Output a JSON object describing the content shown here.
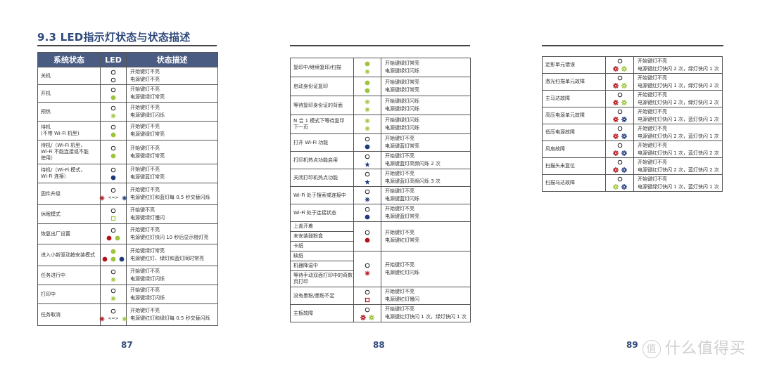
{
  "colors": {
    "header_bg": "#4a5c82",
    "title": "#2f4a7c",
    "green": "#9dc43a",
    "blue": "#1f3a7a",
    "red": "#b5121b"
  },
  "page87": {
    "title": "9.3 LED指示灯状态与状态描述",
    "headers": [
      "系统状态",
      "LED",
      "状态描述"
    ],
    "page_number": "87",
    "rows": [
      {
        "state": "关机",
        "led_top": [
          {
            "icon": "off"
          }
        ],
        "led_bottom": [
          {
            "icon": "off"
          }
        ],
        "desc": [
          "开始键灯不亮",
          "电源键灯不亮"
        ]
      },
      {
        "state": "开机",
        "led_top": [
          {
            "icon": "off"
          }
        ],
        "led_bottom": [
          {
            "icon": "solid",
            "color": "green"
          }
        ],
        "desc": [
          "开始键灯不亮",
          "电源键绿灯常亮"
        ]
      },
      {
        "state": "预热",
        "led_top": [
          {
            "icon": "off"
          }
        ],
        "led_bottom": [
          {
            "icon": "blink",
            "color": "green"
          }
        ],
        "desc": [
          "开始键灯不亮",
          "电源键绿灯闪烁"
        ]
      },
      {
        "state": "待机\n(不带 Wi-Fi 机型)",
        "led_top": [
          {
            "icon": "off"
          }
        ],
        "led_bottom": [
          {
            "icon": "solid",
            "color": "green"
          }
        ],
        "desc": [
          "开始键灯不亮",
          "电源键绿灯常亮"
        ]
      },
      {
        "state": "待机/（Wi-Fi 机型，\nWi-Fi 不能连接或不能\n使用）",
        "led_top": [
          {
            "icon": "off"
          }
        ],
        "led_bottom": [
          {
            "icon": "solid",
            "color": "green"
          }
        ],
        "desc": [
          "开始键灯不亮",
          "电源键绿灯常亮"
        ]
      },
      {
        "state": "待机/（Wi-Fi 模式，\nWi-Fi 连接）",
        "led_top": [
          {
            "icon": "off"
          }
        ],
        "led_bottom": [
          {
            "icon": "solid",
            "color": "blue"
          }
        ],
        "desc": [
          "开始键灯不亮",
          "电源键蓝灯常亮"
        ]
      },
      {
        "state": "固件升级",
        "led_top": [
          {
            "icon": "off"
          }
        ],
        "led_bottom": [
          {
            "icon": "blink",
            "color": "red"
          },
          {
            "icon": "alt"
          },
          {
            "icon": "blink",
            "color": "blue"
          }
        ],
        "desc": [
          "开始键灯不亮",
          "电源键红灯和蓝灯每 0.5 秒交替闪烁"
        ]
      },
      {
        "state": "休眠模式",
        "led_top": [
          {
            "icon": "off"
          }
        ],
        "led_bottom": [
          {
            "icon": "slow",
            "color": "green"
          }
        ],
        "desc": [
          "开始键不亮",
          "电源键绿灯慢闪"
        ]
      },
      {
        "state": "恢复出厂设置",
        "led_top": [
          {
            "icon": "off"
          }
        ],
        "led_bottom": [
          {
            "icon": "solid",
            "color": "red"
          },
          {
            "icon": "solid",
            "color": "green"
          }
        ],
        "desc": [
          "开始键灯不亮",
          "电源键红灯快闪 10 秒后显示橙灯亮"
        ]
      },
      {
        "state": "进入小新驱动按安装模式",
        "led_top": [
          {
            "icon": "solid",
            "color": "green"
          }
        ],
        "led_bottom": [
          {
            "icon": "solid",
            "color": "red"
          },
          {
            "icon": "solid",
            "color": "green"
          },
          {
            "icon": "solid",
            "color": "blue"
          }
        ],
        "desc": [
          "开始键绿灯常亮",
          "电源键红灯、绿灯和蓝灯同时常亮"
        ]
      },
      {
        "state": "任务进行中",
        "led_top": [
          {
            "icon": "off"
          }
        ],
        "led_bottom": [
          {
            "icon": "blink",
            "color": "green"
          }
        ],
        "desc": [
          "开始键灯不亮",
          "电源键绿灯闪烁"
        ]
      },
      {
        "state": "打印中",
        "led_top": [
          {
            "icon": "off"
          }
        ],
        "led_bottom": [
          {
            "icon": "blink",
            "color": "green"
          }
        ],
        "desc": [
          "开始键灯不亮",
          "电源键绿灯闪烁"
        ]
      },
      {
        "state": "任务取消",
        "led_top": [
          {
            "icon": "off"
          }
        ],
        "led_bottom": [
          {
            "icon": "blink",
            "color": "red"
          },
          {
            "icon": "alt"
          },
          {
            "icon": "blink",
            "color": "green"
          }
        ],
        "desc": [
          "开始键灯不亮",
          "电源键红灯和绿灯每 0.5 秒交替闪烁"
        ]
      }
    ]
  },
  "page88": {
    "page_number": "88",
    "rows": [
      {
        "states": [
          "复印中/继续复印/扫描"
        ],
        "led_top": [
          {
            "icon": "solid",
            "color": "green"
          }
        ],
        "led_bottom": [
          {
            "icon": "blink",
            "color": "green"
          }
        ],
        "desc": [
          "开始键绿灯常亮",
          "电源键绿灯闪烁"
        ]
      },
      {
        "states": [
          "启动身份证复印"
        ],
        "led_top": [
          {
            "icon": "solid",
            "color": "green"
          }
        ],
        "led_bottom": [
          {
            "icon": "solid",
            "color": "green"
          }
        ],
        "desc": [
          "开始键绿灯常亮",
          "电源键绿灯常亮"
        ]
      },
      {
        "states": [
          "等待复印身份证的背面"
        ],
        "led_top": [
          {
            "icon": "blink",
            "color": "green"
          }
        ],
        "led_bottom": [
          {
            "icon": "blink",
            "color": "green"
          }
        ],
        "desc": [
          "开始键绿灯闪烁",
          "电源键绿灯闪烁"
        ]
      },
      {
        "states": [
          "N 合 1 模式下等待复印\n下一页"
        ],
        "led_top": [
          {
            "icon": "blink",
            "color": "green"
          }
        ],
        "led_bottom": [
          {
            "icon": "blink",
            "color": "green"
          }
        ],
        "desc": [
          "开始键绿灯闪烁",
          "电源键绿灯闪烁"
        ]
      },
      {
        "states": [
          "打开 Wi-Fi 功能"
        ],
        "led_top": [
          {
            "icon": "off"
          }
        ],
        "led_bottom": [
          {
            "icon": "solid",
            "color": "blue"
          }
        ],
        "desc": [
          "开始键灯不亮",
          "电源键蓝灯常亮"
        ]
      },
      {
        "states": [
          "打印机热点功能启用"
        ],
        "led_top": [
          {
            "icon": "off"
          }
        ],
        "led_bottom": [
          {
            "icon": "star",
            "color": "blue"
          }
        ],
        "desc": [
          "开始键灯不亮",
          "电源键蓝灯高频闪烁 2 次"
        ]
      },
      {
        "states": [
          "关闭打印机热点功能"
        ],
        "led_top": [
          {
            "icon": "off"
          }
        ],
        "led_bottom": [
          {
            "icon": "star",
            "color": "blue"
          }
        ],
        "desc": [
          "开始键灯不亮",
          "电源键蓝灯高频闪烁 3 次"
        ]
      },
      {
        "states": [
          "Wi-Fi 处于搜索或连接中"
        ],
        "led_top": [
          {
            "icon": "off"
          }
        ],
        "led_bottom": [
          {
            "icon": "blink",
            "color": "blue"
          }
        ],
        "desc": [
          "开始键灯不亮",
          "电源键蓝灯闪烁"
        ]
      },
      {
        "states": [
          "Wi-Fi 处于连接状态"
        ],
        "led_top": [
          {
            "icon": "off"
          }
        ],
        "led_bottom": [
          {
            "icon": "solid",
            "color": "blue"
          }
        ],
        "desc": [
          "开始键灯不亮",
          "电源键蓝灯常亮"
        ]
      },
      {
        "states": [
          "上盖开着",
          "未安装鼓粉盒",
          "卡纸"
        ],
        "led_top": [
          {
            "icon": "off"
          }
        ],
        "led_bottom": [
          {
            "icon": "solid",
            "color": "red"
          }
        ],
        "desc": [
          "开始键灯不亮",
          "电源键红灯常亮"
        ]
      },
      {
        "states": [
          "缺纸",
          "机器降温中",
          "等待手动双面打印中的奇数\n页打印"
        ],
        "led_top": [
          {
            "icon": "off"
          }
        ],
        "led_bottom": [
          {
            "icon": "blink",
            "color": "red"
          }
        ],
        "desc": [
          "开始键灯不亮",
          "电源键红灯闪烁"
        ]
      },
      {
        "states": [
          "没有墨粉/墨粉不足"
        ],
        "led_top": [
          {
            "icon": "off"
          }
        ],
        "led_bottom": [
          {
            "icon": "slow",
            "color": "red"
          }
        ],
        "desc": [
          "开始键灯不亮",
          "电源键红灯慢闪"
        ]
      },
      {
        "states": [
          "主板故障"
        ],
        "led_top": [
          {
            "icon": "off"
          }
        ],
        "led_bottom": [
          {
            "icon": "fast",
            "color": "red"
          },
          {
            "icon": "fast",
            "color": "green"
          }
        ],
        "desc": [
          "开始键灯不亮",
          "电源键红灯快闪 1 次，绿灯快闪 1 次"
        ]
      }
    ]
  },
  "page89": {
    "page_number": "89",
    "rows": [
      {
        "state": "定影单元错误",
        "led_top": [
          {
            "icon": "off"
          }
        ],
        "led_bottom": [
          {
            "icon": "fast",
            "color": "red"
          },
          {
            "icon": "fast",
            "color": "green"
          }
        ],
        "desc": [
          "开始键灯不亮",
          "电源键红灯快闪 2 次，绿灯快闪 1 次"
        ]
      },
      {
        "state": "激光扫描单元故障",
        "led_top": [
          {
            "icon": "off"
          }
        ],
        "led_bottom": [
          {
            "icon": "fast",
            "color": "red"
          },
          {
            "icon": "fast",
            "color": "green"
          }
        ],
        "desc": [
          "开始键灯不亮",
          "电源键红灯快闪 1 次，绿灯快闪 2 次"
        ]
      },
      {
        "state": "主马达故障",
        "led_top": [
          {
            "icon": "off"
          }
        ],
        "led_bottom": [
          {
            "icon": "fast",
            "color": "red"
          },
          {
            "icon": "fast",
            "color": "green"
          }
        ],
        "desc": [
          "开始键灯不亮",
          "电源键红灯快闪 2 次，绿灯快闪 2 次"
        ]
      },
      {
        "state": "高压电源单元故障",
        "led_top": [
          {
            "icon": "off"
          }
        ],
        "led_bottom": [
          {
            "icon": "fast",
            "color": "red"
          },
          {
            "icon": "fast",
            "color": "blue"
          }
        ],
        "desc": [
          "开始键灯不亮",
          "电源键红灯快闪 1 次，蓝灯快闪 1 次"
        ]
      },
      {
        "state": "低压电源故障",
        "led_top": [
          {
            "icon": "off"
          }
        ],
        "led_bottom": [
          {
            "icon": "fast",
            "color": "red"
          },
          {
            "icon": "fast",
            "color": "blue"
          }
        ],
        "desc": [
          "开始键灯不亮",
          "电源键红灯快闪 2 次，蓝灯快闪 1 次"
        ]
      },
      {
        "state": "风扇故障",
        "led_top": [
          {
            "icon": "off"
          }
        ],
        "led_bottom": [
          {
            "icon": "fast",
            "color": "red"
          },
          {
            "icon": "fast",
            "color": "blue"
          }
        ],
        "desc": [
          "开始键灯不亮",
          "电源键红灯快闪 1 次，蓝灯快闪 2 次"
        ]
      },
      {
        "state": "扫描头未复位",
        "led_top": [
          {
            "icon": "off"
          }
        ],
        "led_bottom": [
          {
            "icon": "fast",
            "color": "red"
          },
          {
            "icon": "fast",
            "color": "blue"
          }
        ],
        "desc": [
          "开始键灯不亮",
          "电源键红灯快闪 2 次，蓝灯快闪 2 次"
        ]
      },
      {
        "state": "扫描马达故障",
        "led_top": [
          {
            "icon": "off"
          }
        ],
        "led_bottom": [
          {
            "icon": "fast",
            "color": "green"
          },
          {
            "icon": "fast",
            "color": "blue"
          }
        ],
        "desc": [
          "开始键灯不亮",
          "电源键绿灯快闪 1 次，蓝灯快闪 1 次"
        ]
      }
    ]
  },
  "watermark": {
    "badge": "值",
    "text": "什么值得买"
  }
}
